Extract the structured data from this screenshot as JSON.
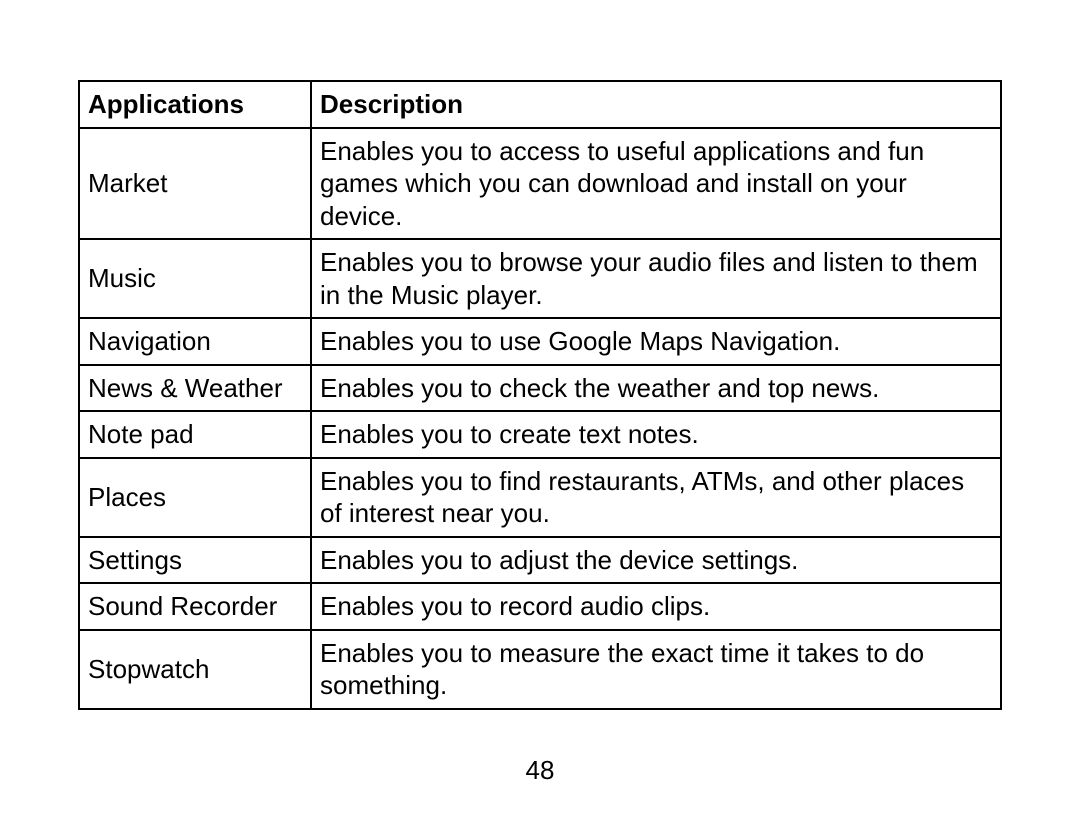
{
  "table": {
    "headers": {
      "col1": "Applications",
      "col2": "Description"
    },
    "rows": [
      {
        "app": "Market",
        "desc": "Enables you to access to useful applications and fun games which you can download and install on your device."
      },
      {
        "app": "Music",
        "desc": "Enables you to browse your audio files and listen to them in the Music player."
      },
      {
        "app": "Navigation",
        "desc": "Enables you to use Google Maps Navigation."
      },
      {
        "app": "News & Weather",
        "desc": "Enables you to check the weather and top news."
      },
      {
        "app": "Note pad",
        "desc": "Enables you to create text notes."
      },
      {
        "app": "Places",
        "desc": "Enables you to find restaurants, ATMs, and other places of interest near you."
      },
      {
        "app": "Settings",
        "desc": "Enables you to adjust the device settings."
      },
      {
        "app": "Sound Recorder",
        "desc": "Enables you to record audio clips."
      },
      {
        "app": "Stopwatch",
        "desc": "Enables you to measure the exact time it takes to do something."
      }
    ]
  },
  "page_number": "48"
}
